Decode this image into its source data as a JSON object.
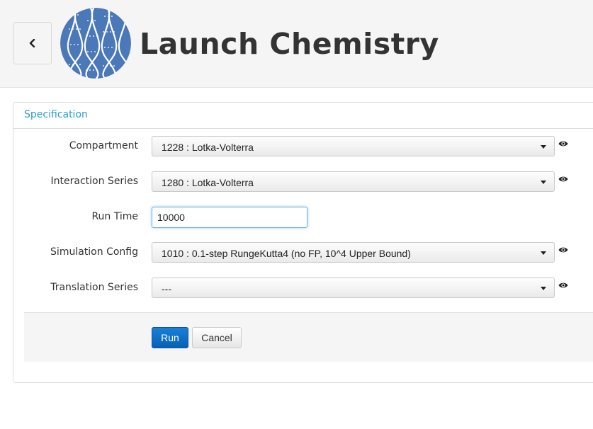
{
  "header": {
    "title": "Launch Chemistry",
    "back_icon": "chevron-left-icon",
    "logo_icon": "dna-helix-logo"
  },
  "panel": {
    "heading": "Specification"
  },
  "form": {
    "compartment": {
      "label": "Compartment",
      "value": "1228 : Lotka-Volterra"
    },
    "interaction_series": {
      "label": "Interaction Series",
      "value": "1280 : Lotka-Volterra"
    },
    "run_time": {
      "label": "Run Time",
      "value": "10000"
    },
    "simulation_config": {
      "label": "Simulation Config",
      "value": "1010 : 0.1-step RungeKutta4 (no FP, 10^4 Upper Bound)"
    },
    "translation_series": {
      "label": "Translation Series",
      "value": "---"
    }
  },
  "actions": {
    "run_label": "Run",
    "cancel_label": "Cancel"
  },
  "colors": {
    "accent": "#2a9fd6",
    "primary_button": "#0661b5",
    "logo_blue": "#4a78b8"
  }
}
